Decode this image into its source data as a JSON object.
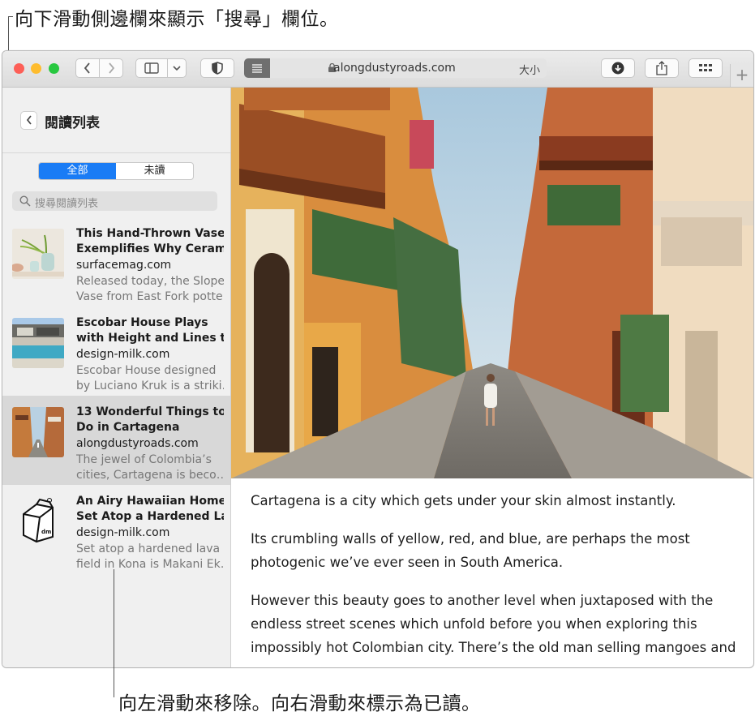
{
  "callouts": {
    "top": "向下滑動側邊欄來顯示「搜尋」欄位。",
    "bottom": "向左滑動來移除。向右滑動來標示為已讀。"
  },
  "toolbar": {
    "url": "alongdustyroads.com",
    "text_size": "大小",
    "icons": [
      "back-icon",
      "forward-icon",
      "sidebar-icon",
      "chevron-down-icon",
      "privacy-shield-icon",
      "reader-icon",
      "lock-icon",
      "download-icon",
      "share-icon",
      "tab-overview-icon",
      "new-tab-icon"
    ]
  },
  "sidebar": {
    "title": "閱讀列表",
    "segments": {
      "all": "全部",
      "unread": "未讀"
    },
    "search_placeholder": "搜尋閱讀列表",
    "items": [
      {
        "title1": "This Hand-Thrown Vase",
        "title2": "Exemplifies Why Ceram…",
        "domain": "surfacemag.com",
        "ex1": "Released today, the Slope",
        "ex2": "Vase from East Fork potte…"
      },
      {
        "title1": "Escobar House Plays",
        "title2": "with Height and Lines t…",
        "domain": "design-milk.com",
        "ex1": "Escobar House designed",
        "ex2": "by Luciano Kruk is a striki…"
      },
      {
        "title1": "13 Wonderful Things to",
        "title2": "Do in Cartagena",
        "domain": "alongdustyroads.com",
        "ex1": "The jewel of Colombia’s",
        "ex2": "cities, Cartagena is beco…"
      },
      {
        "title1": "An Airy Hawaiian Home",
        "title2": "Set Atop a Hardened La…",
        "domain": "design-milk.com",
        "ex1": "Set atop a hardened lava",
        "ex2": "field in Kona is Makani Ek…"
      }
    ]
  },
  "article": {
    "p1": "Cartagena is a city which gets under your skin almost instantly.",
    "p2a": "Its crumbling walls of yellow, red, and blue, are perhaps the most",
    "p2b": "photogenic we’ve ever seen in South America.",
    "p3a": "However this beauty goes to another level when juxtaposed with the",
    "p3b": "endless street scenes which unfold before you when exploring this",
    "p3c": "impossibly hot Colombian city. There’s the old man selling mangoes and"
  },
  "colors": {
    "accent": "#1a7cf5",
    "close": "#fd5f57",
    "minimize": "#febc2e",
    "zoom": "#28c840"
  }
}
